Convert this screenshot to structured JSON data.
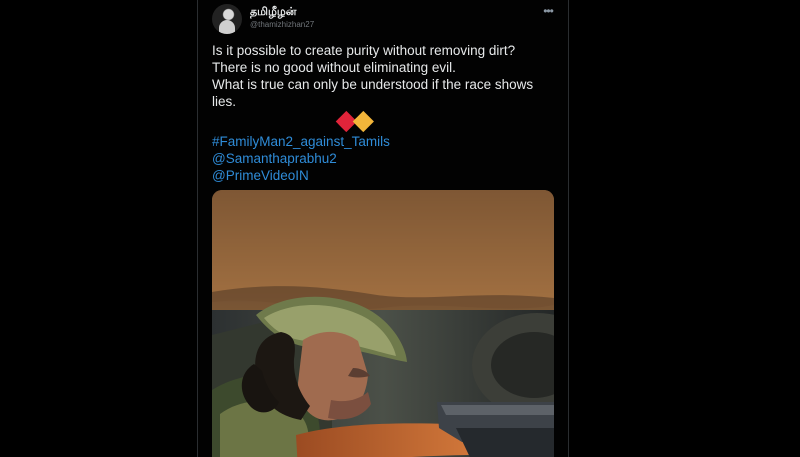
{
  "tweet": {
    "display_name": "தமிழீழன்",
    "handle": "@thamizhizhan27",
    "more_icon": "more-horizontal-icon",
    "text_lines": [
      "Is it possible to create purity without removing dirt?",
      "There is no good without eliminating evil.",
      "What is true can only be understood if the race shows lies."
    ],
    "emojis": [
      "red-heart-icon",
      "yellow-heart-icon"
    ],
    "links": [
      "#FamilyMan2_against_Tamils",
      "@Samanthaprabhu2",
      "@PrimeVideoIN"
    ]
  },
  "colors": {
    "background": "#000000",
    "text": "#e7e9ea",
    "secondary_text": "#71767b",
    "link": "#2f8cd8",
    "red_heart": "#e0243a",
    "yellow_heart": "#f2b53a"
  }
}
